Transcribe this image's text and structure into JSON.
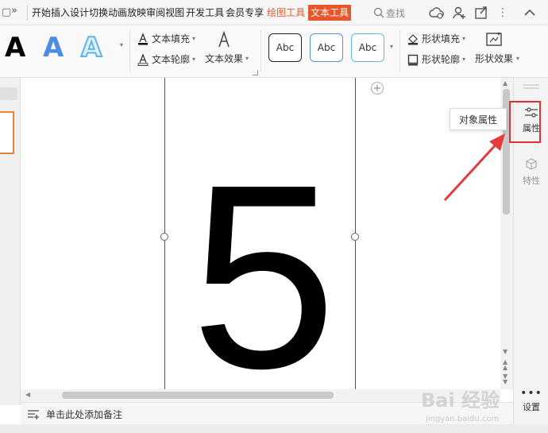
{
  "menu": {
    "tabs": [
      "开始",
      "插入",
      "设计",
      "切换",
      "动画",
      "放映",
      "审阅",
      "视图",
      "开发工具",
      "会员专享",
      "绘图工具",
      "文本工具"
    ],
    "search_label": "查找"
  },
  "ribbon": {
    "text_fill": "文本填充",
    "text_outline": "文本轮廓",
    "text_effect": "文本效果",
    "shape_fill": "形状填充",
    "shape_outline": "形状轮廓",
    "shape_effect": "形状效果",
    "style_samples": [
      "Abc",
      "Abc",
      "Abc"
    ],
    "wordart_letter": "A"
  },
  "canvas": {
    "big_number": "5"
  },
  "notes": {
    "placeholder": "单击此处添加备注"
  },
  "right_panel": {
    "properties": "属性",
    "features": "特性",
    "settings": "设置",
    "tooltip": "对象属性"
  },
  "colors": {
    "accent": "#e8572b",
    "highlight": "#e03030",
    "wordart_blue": "#3f86e0"
  },
  "watermark": {
    "text": "Bai 经验",
    "url": "jingyan.baidu.com"
  }
}
